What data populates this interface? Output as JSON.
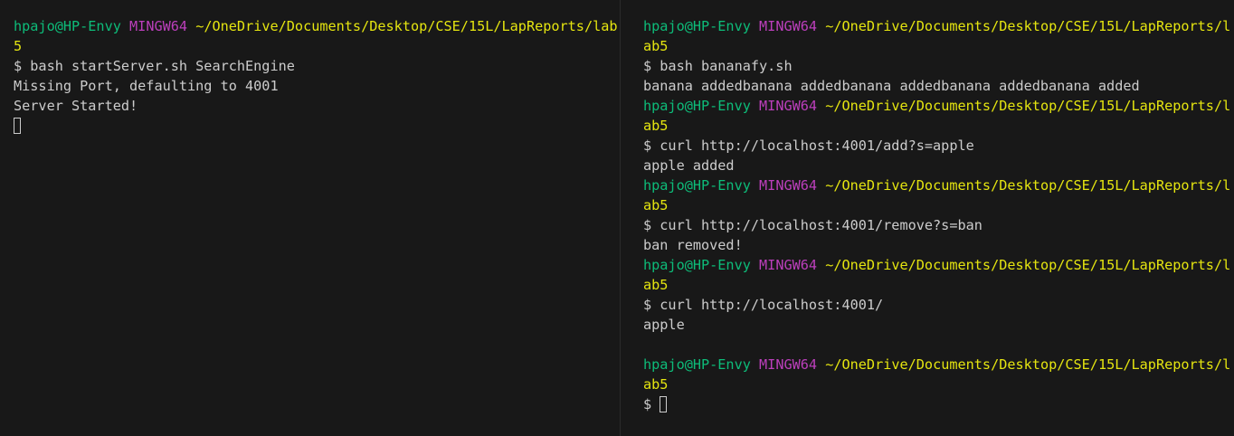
{
  "colors": {
    "background": "#181818",
    "user": "#0dbc79",
    "host": "#bc3fbc",
    "path": "#e5e510",
    "text": "#cccccc"
  },
  "left": {
    "prompt": {
      "user": "hpajo@HP-Envy",
      "host": "MINGW64",
      "path_line1": "~/OneDrive/Documents/Desktop/CSE/15L/LapReports/lab",
      "path_line2": "5"
    },
    "command": "$ bash startServer.sh SearchEngine",
    "output": [
      "Missing Port, defaulting to 4001",
      "Server Started!"
    ]
  },
  "right": {
    "prompt": {
      "user": "hpajo@HP-Envy",
      "host": "MINGW64",
      "path_line1": "~/OneDrive/Documents/Desktop/CSE/15L/LapReports/l",
      "path_line2": "ab5"
    },
    "blocks": [
      {
        "command": "$ bash bananafy.sh",
        "output": "banana addedbanana addedbanana addedbanana addedbanana added"
      },
      {
        "command": "$ curl http://localhost:4001/add?s=apple",
        "output": "apple added"
      },
      {
        "command": "$ curl http://localhost:4001/remove?s=ban",
        "output": "ban removed!"
      },
      {
        "command": "$ curl http://localhost:4001/",
        "output": "apple"
      }
    ],
    "final_prompt_symbol": "$"
  }
}
